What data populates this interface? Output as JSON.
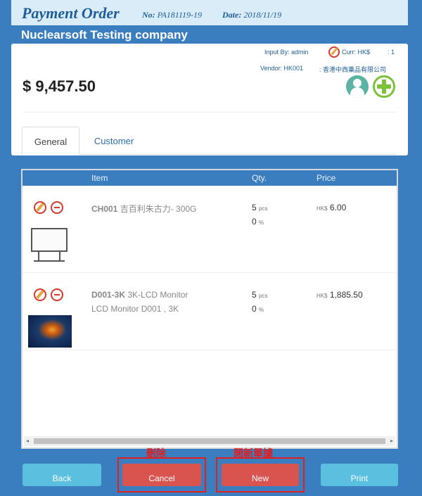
{
  "header": {
    "title": "Payment Order",
    "no_label": "No:",
    "no_value": "PA181119-19",
    "date_label": "Date:",
    "date_value": "2018/11/19"
  },
  "company": "Nuclearsoft Testing company",
  "summary": {
    "input_by": "Input By: admin",
    "currency": "Curr: HK$",
    "rate": ": 1",
    "vendor": "Vendor: HK001",
    "vendor_name": ": 香港中西藥品有限公司",
    "amount": "$ 9,457.50"
  },
  "tabs": [
    {
      "label": "General"
    },
    {
      "label": "Customer"
    }
  ],
  "list": {
    "columns": [
      "Item",
      "Qty.",
      "Price"
    ],
    "rows": [
      {
        "code": "CH001",
        "desc": "吉百利朱古力- 300G",
        "desc2": "",
        "qty": "5",
        "qty_unit": "pcs",
        "discount": "0",
        "discount_unit": "%",
        "currency": "HK$",
        "price": "6.00",
        "image": "whiteboard"
      },
      {
        "code": "D001-3K",
        "desc": "3K-LCD Monitor",
        "desc2": "LCD Monitor D001 , 3K",
        "qty": "5",
        "qty_unit": "pcs",
        "discount": "0",
        "discount_unit": "%",
        "currency": "HK$",
        "price": "1,885.50",
        "image": "jellyfish"
      }
    ]
  },
  "buttons": {
    "back": "Back",
    "cancel": "Cancel",
    "new": "New",
    "print": "Print"
  },
  "annotations": {
    "cancel": "刪除",
    "new": "開新單據"
  },
  "colors": {
    "background": "#3a7ec0",
    "danger": "#d9534f",
    "info": "#5bbfdf",
    "highlight": "#e02020"
  }
}
